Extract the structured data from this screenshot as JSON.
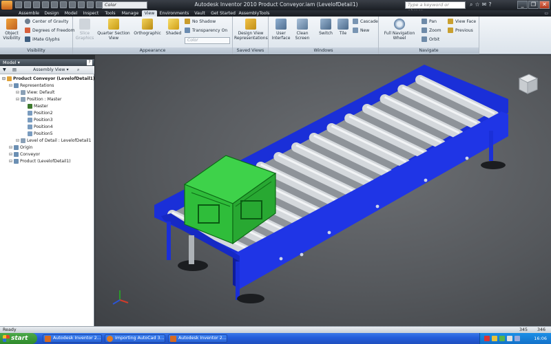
{
  "window": {
    "title": "Autodesk Inventor 2010   Product Conveyor.iam (LevelofDetail1)",
    "color_selector": "Color",
    "search_placeholder": "Type a keyword or phrase"
  },
  "tabs": [
    "Assemble",
    "Design",
    "Model",
    "Inspect",
    "Tools",
    "Manage",
    "View",
    "Environments",
    "Vault",
    "Get Started",
    "AssemblyTools"
  ],
  "active_tab": "View",
  "ribbon": {
    "visibility": {
      "title": "Visibility",
      "object_visibility": "Object\nVisibility",
      "center_of_gravity": "Center of Gravity",
      "degrees_of_freedom": "Degrees of Freedom",
      "imate_glyphs": "iMate Glyphs"
    },
    "appearance": {
      "title": "Appearance",
      "slice_graphics": "Slice\nGraphics",
      "quarter_section_view": "Quarter Section\nView",
      "orthographic": "Orthographic",
      "shaded": "Shaded",
      "no_shadow": "No Shadow",
      "transparency_on": "Transparency On",
      "color": "Color"
    },
    "saved_views": {
      "title": "Saved Views",
      "design_view_representations": "Design View\nRepresentations"
    },
    "windows": {
      "title": "Windows",
      "user_interface": "User\nInterface",
      "clean_screen": "Clean\nScreen",
      "switch": "Switch",
      "tile": "Tile",
      "cascade": "Cascade",
      "new": "New"
    },
    "navigate": {
      "title": "Navigate",
      "full_navigation_wheel": "Full Navigation\nWheel",
      "pan": "Pan",
      "zoom": "Zoom",
      "orbit": "Orbit",
      "view_face": "View Face",
      "previous": "Previous"
    }
  },
  "browser": {
    "header": "Model",
    "pin": "?",
    "toolbar_label": "Assembly View",
    "tree": [
      {
        "label": "Product Conveyor (LevelofDetail1)",
        "indent": 0,
        "bold": true
      },
      {
        "label": "Representations",
        "indent": 1
      },
      {
        "label": "View: Default",
        "indent": 2
      },
      {
        "label": "Position : Master",
        "indent": 2
      },
      {
        "label": "Master",
        "indent": 3,
        "checked": true
      },
      {
        "label": "Position2",
        "indent": 3
      },
      {
        "label": "Position3",
        "indent": 3
      },
      {
        "label": "Position4",
        "indent": 3
      },
      {
        "label": "Position5",
        "indent": 3
      },
      {
        "label": "Level of Detail : LevelofDetail1",
        "indent": 2
      },
      {
        "label": "Origin",
        "indent": 1
      },
      {
        "label": "Conveyor",
        "indent": 1
      },
      {
        "label": "Product (LevelofDetail1)",
        "indent": 1
      }
    ]
  },
  "status": {
    "text": "Ready",
    "value1": "345",
    "value2": "346"
  },
  "taskbar": {
    "start": "start",
    "tasks": [
      "Autodesk Inventor 2...",
      "Importing AutoCad 3...",
      "Autodesk Inventor 2..."
    ],
    "clock": "16:06"
  },
  "colors": {
    "conveyor_frame": "#1a2fd8",
    "crate": "#2fbd3a",
    "rollers": "#c9cdd1",
    "viewport_bg": "#5a5d61"
  }
}
